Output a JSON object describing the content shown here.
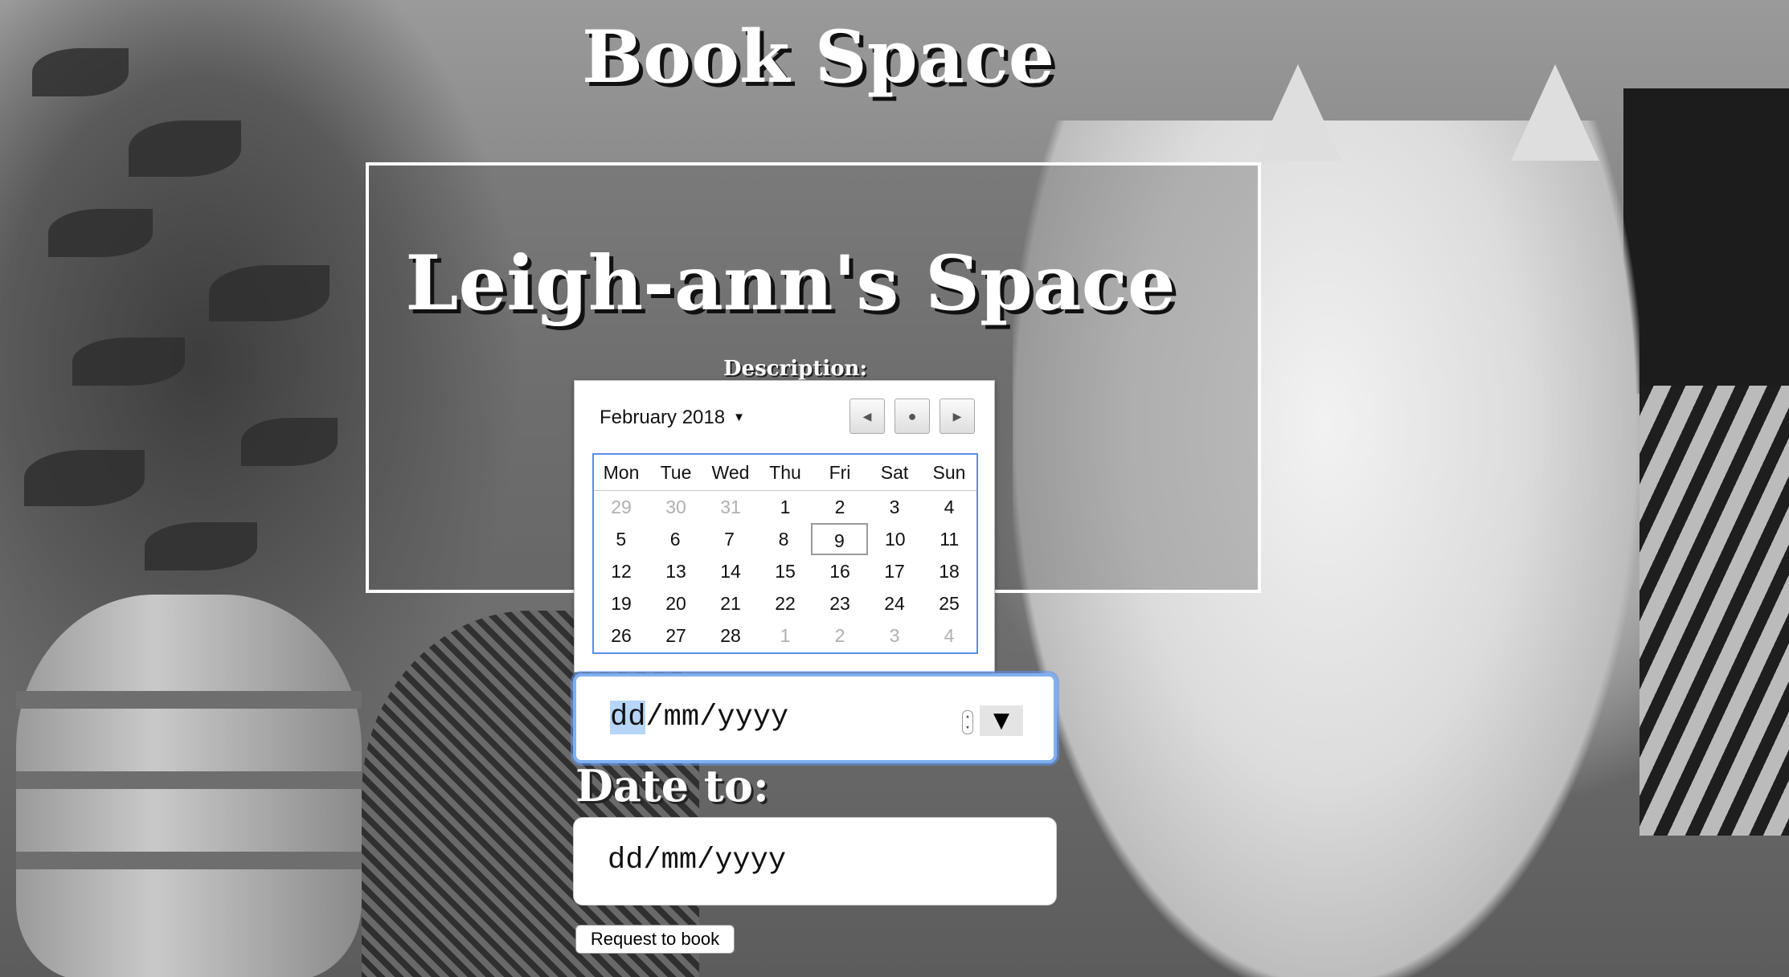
{
  "page": {
    "title": "Book Space"
  },
  "space": {
    "name": "Leigh-ann's Space",
    "description_label": "Description:"
  },
  "calendar": {
    "month_label": "February 2018",
    "weekdays": [
      "Mon",
      "Tue",
      "Wed",
      "Thu",
      "Fri",
      "Sat",
      "Sun"
    ],
    "weeks": [
      [
        "29",
        "30",
        "31",
        "1",
        "2",
        "3",
        "4"
      ],
      [
        "5",
        "6",
        "7",
        "8",
        "9",
        "10",
        "11"
      ],
      [
        "12",
        "13",
        "14",
        "15",
        "16",
        "17",
        "18"
      ],
      [
        "19",
        "20",
        "21",
        "22",
        "23",
        "24",
        "25"
      ],
      [
        "26",
        "27",
        "28",
        "1",
        "2",
        "3",
        "4"
      ]
    ],
    "today": "9",
    "accent_color": "#5b8ee6"
  },
  "date_from": {
    "placeholder_day": "dd",
    "placeholder_month": "mm",
    "placeholder_year": "yyyy",
    "separator": "/",
    "dropdown_glyph": "▼"
  },
  "date_to": {
    "label": "Date to:",
    "placeholder": "dd/mm/yyyy"
  },
  "actions": {
    "request_label": "Request to book"
  }
}
